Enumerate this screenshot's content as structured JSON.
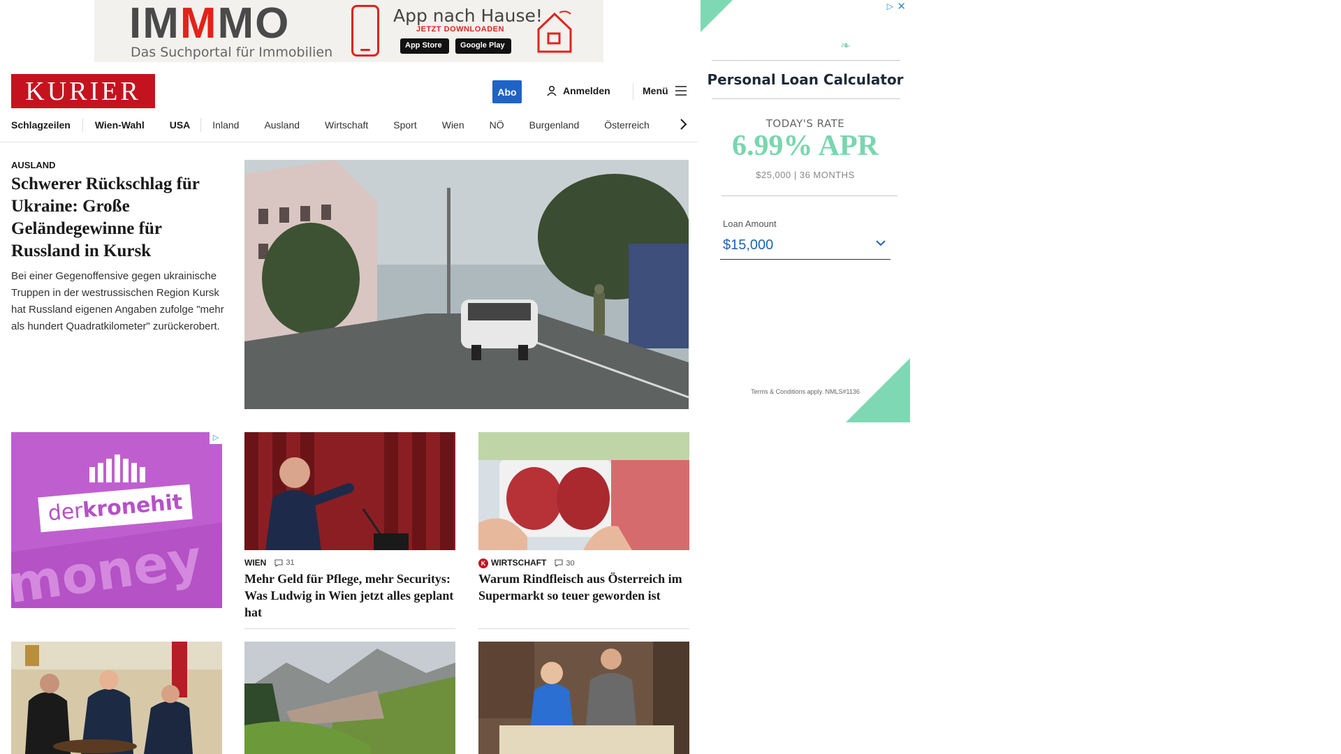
{
  "top_ad": {
    "brand_pre": "IM",
    "brand_m": "M",
    "brand_post": "MO",
    "tagline": "Das Suchportal für Immobilien",
    "title": "App nach Hause!",
    "cta": "JETZT DOWNLOADEN",
    "app_store": "App Store",
    "google_play": "Google Play"
  },
  "right_ad": {
    "title": "Personal Loan Calculator",
    "rate_label": "TODAY'S RATE",
    "rate": "6.99% APR",
    "rate_sub": "$25,000 | 36 MONTHS",
    "loan_label": "Loan Amount",
    "loan_value": "$15,000",
    "terms": "Terms & Conditions apply. NMLS#1136",
    "accent_color": "#79d6ae"
  },
  "header": {
    "logo": "KURIER",
    "abo": "Abo",
    "login": "Anmelden",
    "menu": "Menü",
    "brand_color": "#c4131f"
  },
  "nav": [
    "Schlagzeilen",
    "Wien-Wahl",
    "USA",
    "Inland",
    "Ausland",
    "Wirtschaft",
    "Sport",
    "Wien",
    "NÖ",
    "Burgenland",
    "Österreich"
  ],
  "lead": {
    "category": "AUSLAND",
    "title": "Schwerer Rückschlag für Ukraine: Große Geländegewinne für Russland in Kursk",
    "teaser": "Bei einer Gegenoffensive gegen ukrainische Truppen in der westrussischen Region Kursk hat Russland eigenen Angaben zufolge \"mehr als hundert Quadratkilometer\" zurückerobert."
  },
  "ad_krone": {
    "brand_pre": "der",
    "brand_main": "kronehit",
    "bg_text": "money m"
  },
  "cards": [
    {
      "category": "WIEN",
      "comments": "31",
      "title": "Mehr Geld für Pflege, mehr Securitys: Was Ludwig in Wien jetzt alles geplant hat"
    },
    {
      "category": "WIRTSCHAFT",
      "comments": "30",
      "title": "Warum Rindfleisch aus Österreich im Supermarkt so teuer geworden ist"
    }
  ]
}
